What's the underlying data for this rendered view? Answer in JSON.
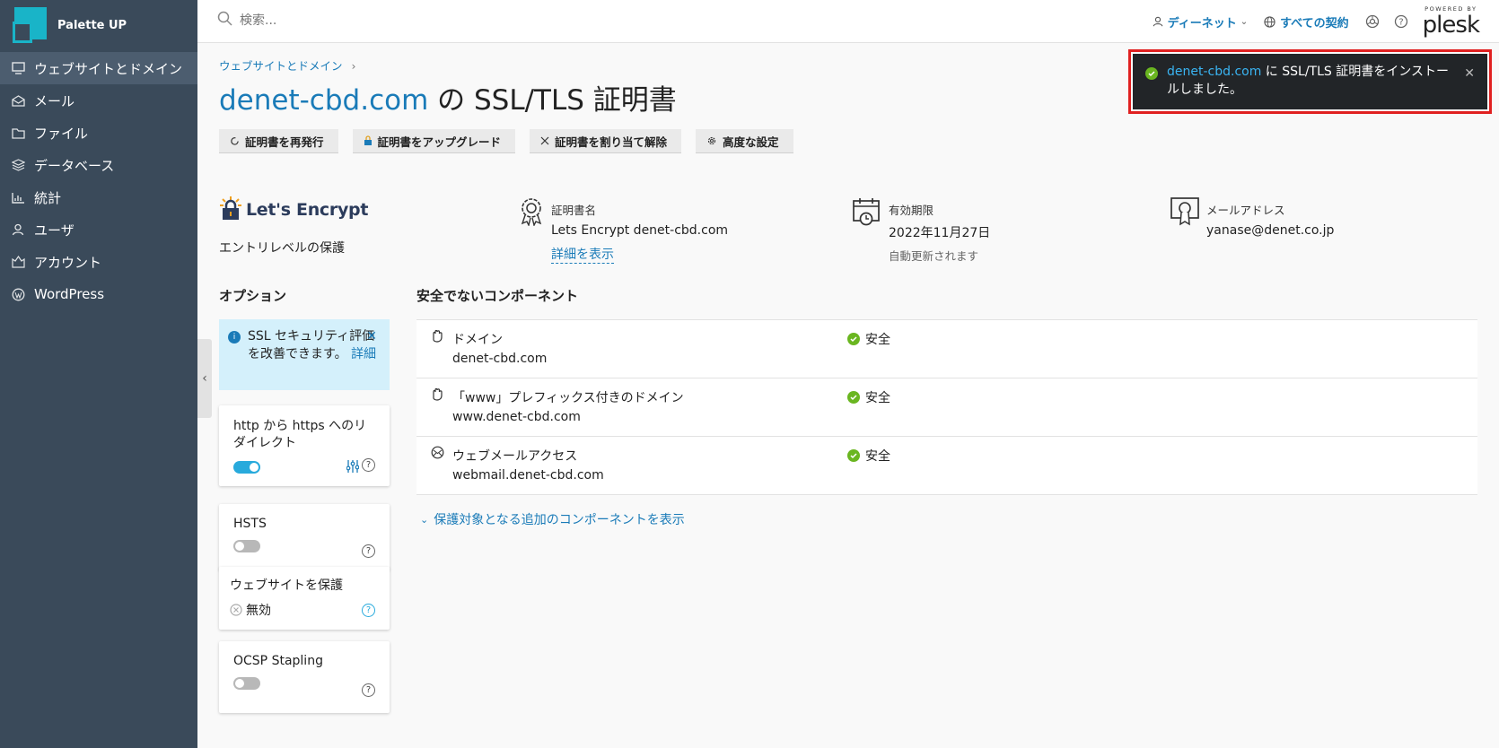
{
  "brand": {
    "name": "Palette UP"
  },
  "sidebar": {
    "items": [
      {
        "label": "ウェブサイトとドメイン",
        "icon": "monitor-icon",
        "active": true
      },
      {
        "label": "メール",
        "icon": "mail-icon"
      },
      {
        "label": "ファイル",
        "icon": "folder-icon"
      },
      {
        "label": "データベース",
        "icon": "database-icon"
      },
      {
        "label": "統計",
        "icon": "chart-icon"
      },
      {
        "label": "ユーザ",
        "icon": "user-icon"
      },
      {
        "label": "アカウント",
        "icon": "account-icon"
      },
      {
        "label": "WordPress",
        "icon": "wordpress-icon"
      }
    ]
  },
  "header": {
    "search_placeholder": "検索...",
    "user_label": "ディーネット",
    "subscriptions_label": "すべての契約",
    "plesk_powered": "POWERED BY",
    "plesk_name": "plesk"
  },
  "breadcrumb": {
    "item": "ウェブサイトとドメイン"
  },
  "page": {
    "title_domain": "denet-cbd.com",
    "title_rest": " の SSL/TLS 証明書"
  },
  "toolbar": {
    "reissue": "証明書を再発行",
    "upgrade": "証明書をアップグレード",
    "unassign": "証明書を割り当て解除",
    "advanced": "高度な設定"
  },
  "cert": {
    "provider": "Let's Encrypt",
    "level": "エントリレベルの保護",
    "name_label": "証明書名",
    "name_value": "Lets Encrypt denet-cbd.com",
    "details_link": "詳細を表示",
    "expiry_label": "有効期限",
    "expiry_value": "2022年11月27日",
    "expiry_note": "自動更新されます",
    "email_label": "メールアドレス",
    "email_value": "yanase@denet.co.jp"
  },
  "options": {
    "title": "オプション",
    "notice_text": "SSL セキュリティ評価を改善できます。",
    "notice_link": "詳細",
    "redirect_label": "http から https へのリダイレクト",
    "redirect_on": true,
    "hsts_label": "HSTS",
    "hsts_on": false,
    "protect_label": "ウェブサイトを保護",
    "protect_value": "無効",
    "ocsp_label": "OCSP Stapling",
    "ocsp_on": false
  },
  "components": {
    "title": "安全でないコンポーネント",
    "rows": [
      {
        "name": "ドメイン",
        "domain": "denet-cbd.com",
        "status": "安全"
      },
      {
        "name": "「www」プレフィックス付きのドメイン",
        "domain": "www.denet-cbd.com",
        "status": "安全"
      },
      {
        "name": "ウェブメールアクセス",
        "domain": "webmail.denet-cbd.com",
        "status": "安全"
      }
    ],
    "more_link": "保護対象となる追加のコンポーネントを表示"
  },
  "toast": {
    "domain": "denet-cbd.com",
    "message": " に SSL/TLS 証明書をインストールしました。"
  },
  "colors": {
    "sidebar": "#3a4a5a",
    "accent": "#1a7bb8",
    "ok": "#6ab620",
    "toast_frame": "#e02020"
  }
}
